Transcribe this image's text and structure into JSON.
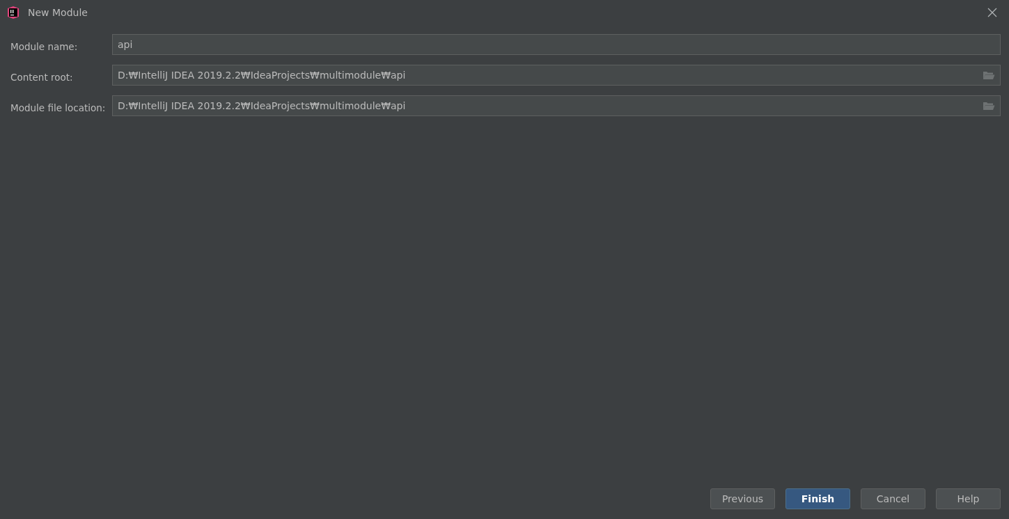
{
  "window": {
    "title": "New Module"
  },
  "fields": [
    {
      "label": "Module name:",
      "value": "api",
      "kind": "text"
    },
    {
      "label": "Content root:",
      "value": "D:₩IntelliJ IDEA 2019.2.2₩IdeaProjects₩multimodule₩api",
      "kind": "path"
    },
    {
      "label": "Module file location:",
      "value": "D:₩IntelliJ IDEA 2019.2.2₩IdeaProjects₩multimodule₩api",
      "kind": "path"
    }
  ],
  "buttons": [
    {
      "label": "Previous",
      "primary": false
    },
    {
      "label": "Finish",
      "primary": true
    },
    {
      "label": "Cancel",
      "primary": false
    },
    {
      "label": "Help",
      "primary": false
    }
  ]
}
